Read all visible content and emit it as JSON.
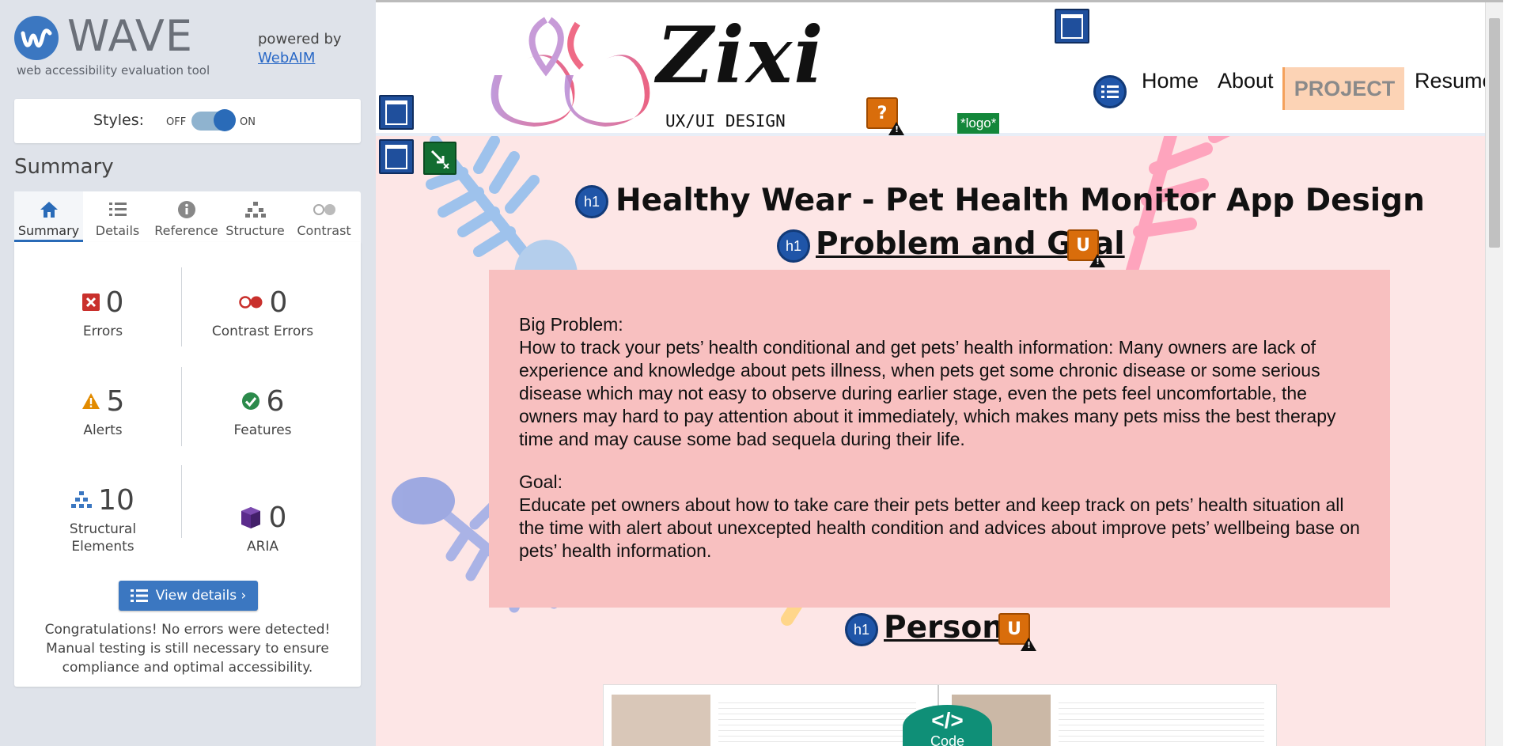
{
  "wave": {
    "brand": "WAVE",
    "tagline": "web accessibility evaluation tool",
    "powered_by": "powered by",
    "powered_link": "WebAIM",
    "styles_label": "Styles:",
    "toggle_off": "OFF",
    "toggle_on": "ON",
    "summary_title": "Summary",
    "tabs": [
      {
        "label": "Summary",
        "icon": "home-icon"
      },
      {
        "label": "Details",
        "icon": "list-icon"
      },
      {
        "label": "Reference",
        "icon": "info-icon"
      },
      {
        "label": "Structure",
        "icon": "structure-icon"
      },
      {
        "label": "Contrast",
        "icon": "contrast-icon"
      }
    ],
    "stats": {
      "errors": {
        "value": "0",
        "label": "Errors"
      },
      "contrast_errors": {
        "value": "0",
        "label": "Contrast Errors"
      },
      "alerts": {
        "value": "5",
        "label": "Alerts"
      },
      "features": {
        "value": "6",
        "label": "Features"
      },
      "structural": {
        "value": "10",
        "label": "Structural Elements"
      },
      "aria": {
        "value": "0",
        "label": "ARIA"
      }
    },
    "view_details": "View details ›",
    "congrats": "Congratulations! No errors were detected! Manual testing is still necessary to ensure compliance and optimal accessibility."
  },
  "site": {
    "logo_text": "Zixi",
    "logo_sub": "UX/UI DESIGN",
    "logo_tag": "*logo*",
    "nav": [
      "Home",
      "About",
      "PROJECT",
      "Resume"
    ],
    "h1_icon": "h1",
    "alert_u": "U",
    "alert_q": "?",
    "title": "Healthy Wear - Pet Health Monitor App Design",
    "section1": "Problem and Goal",
    "problem_label": "Big Problem:",
    "problem_text": "How to track your pets’ health conditional and get pets’ health information: Many owners are lack of experience and knowledge about pets illness, when pets get some chronic disease or some serious disease which may not easy to observe during earlier stage, even the pets feel uncomfortable, the owners may hard to pay attention about it immediately, which makes many pets miss the best therapy time and may cause some bad sequela during their life.",
    "goal_label": "Goal:",
    "goal_text": "Educate pet owners about how to take care their pets better and keep track on pets’ health situation all the time with alert about unexcepted health condition and advices about improve pets’ wellbeing base on pets’ health information.",
    "section2": "Persona",
    "code_label": "Code",
    "code_glyph": "</>"
  },
  "colors": {
    "wave_blue": "#2a6bb8",
    "page_bg": "#fde6e6",
    "panel_bg": "#f8c0c0",
    "error_red": "#c9302c",
    "alert_orange": "#e28b00",
    "feature_green": "#2b8a4b",
    "aria_purple": "#5b2b8c"
  }
}
